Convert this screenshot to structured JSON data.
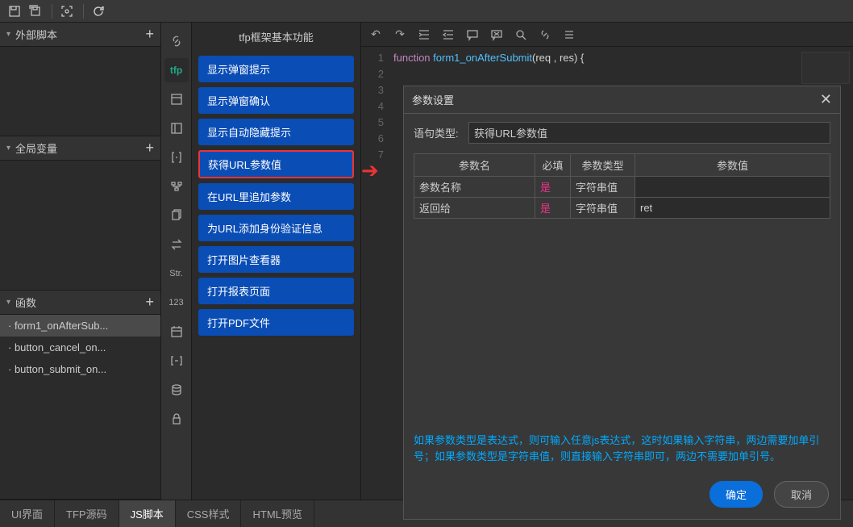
{
  "topbar": {},
  "leftPanels": {
    "external": {
      "title": "外部脚本"
    },
    "globals": {
      "title": "全局变量"
    },
    "functions": {
      "title": "函数",
      "items": [
        "· form1_onAfterSub...",
        "· button_cancel_on...",
        "· button_submit_on..."
      ]
    }
  },
  "sideIcons": {
    "tfp": "tfp",
    "str": "Str.",
    "num": "123"
  },
  "cmdPanel": {
    "title": "tfp框架基本功能",
    "items": [
      "显示弹窗提示",
      "显示弹窗确认",
      "显示自动隐藏提示",
      "获得URL参数值",
      "在URL里追加参数",
      "为URL添加身份验证信息",
      "打开图片查看器",
      "打开报表页面",
      "打开PDF文件"
    ]
  },
  "editor": {
    "lineNumbers": [
      "1",
      "2",
      "3",
      "4",
      "5",
      "6",
      "7"
    ],
    "code": {
      "keyword": "function",
      "funcName": "form1_onAfterSubmit",
      "params": "(req , res) {"
    }
  },
  "dialog": {
    "title": "参数设置",
    "typeLabel": "语句类型:",
    "typeValue": "获得URL参数值",
    "headers": [
      "参数名",
      "必填",
      "参数类型",
      "参数值"
    ],
    "rows": [
      {
        "name": "参数名称",
        "required": "是",
        "type": "字符串值",
        "value": ""
      },
      {
        "name": "返回给",
        "required": "是",
        "type": "字符串值",
        "value": "ret"
      }
    ],
    "note": "如果参数类型是表达式，则可输入任意js表达式，这时如果输入字符串，两边需要加单引号；如果参数类型是字符串值，则直接输入字符串即可，两边不需要加单引号。",
    "ok": "确定",
    "cancel": "取消"
  },
  "bottomTabs": [
    "UI界面",
    "TFP源码",
    "JS脚本",
    "CSS样式",
    "HTML预览"
  ]
}
